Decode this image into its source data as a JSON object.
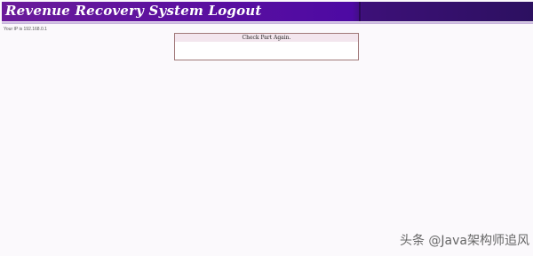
{
  "header": {
    "title": "Revenue Recovery System Logout"
  },
  "ip_line": "Your IP is 192.168.0.1",
  "message_box": {
    "heading": "Check Part Again."
  },
  "watermark": "头条 @Java架构师追风"
}
